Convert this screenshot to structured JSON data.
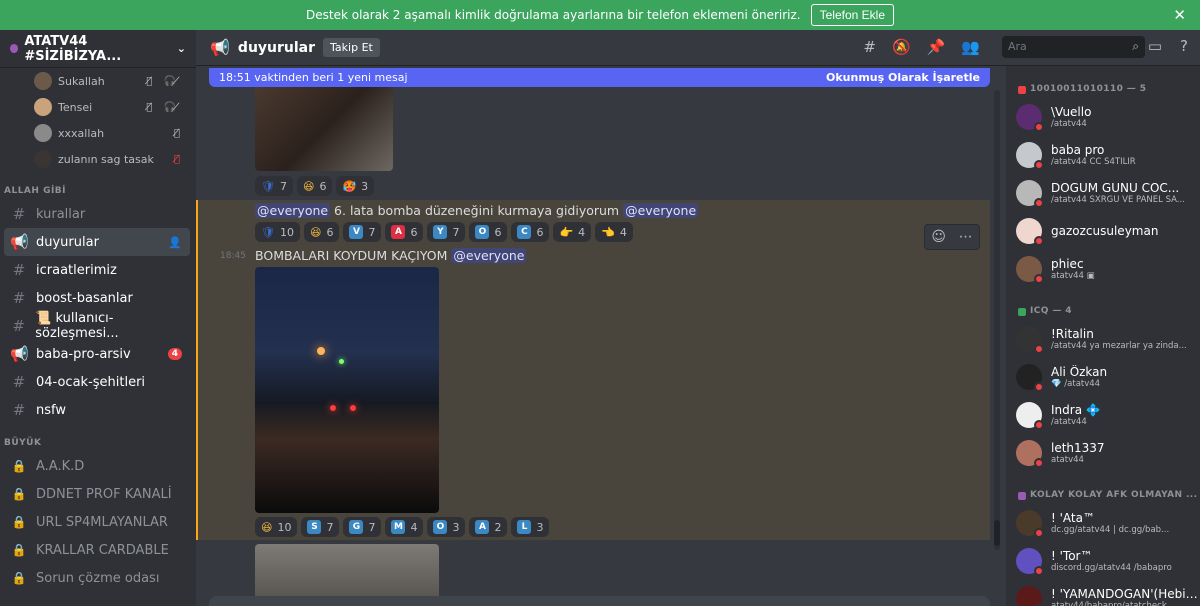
{
  "banner": {
    "text": "Destek olarak 2 aşamalı kimlik doğrulama ayarlarına bir telefon eklemeni öneririz.",
    "button": "Telefon Ekle",
    "close": "✕"
  },
  "server": {
    "name": "ATATV44 #SİZİBİZYA...",
    "chevron": "⌄"
  },
  "voice_users": [
    {
      "name": "Sukallah",
      "icons": "🎙̸ 🎧̸"
    },
    {
      "name": "Tensei",
      "icons": "🎙̸ 🎧̸"
    },
    {
      "name": "xxxallah",
      "icons": "🎙̸"
    },
    {
      "name": "zulanın sag tasak",
      "icons": "🎙̸"
    }
  ],
  "categories": {
    "allah": "ALLAH GİBİ",
    "buyuk": "BÜYÜK"
  },
  "channels_allah": [
    {
      "name": "kurallar",
      "icon": "#",
      "state": "muted"
    },
    {
      "name": "duyurular",
      "icon": "📢",
      "state": "active"
    },
    {
      "name": "icraatlerimiz",
      "icon": "#",
      "state": "unread"
    },
    {
      "name": "boost-basanlar",
      "icon": "#",
      "state": "unread"
    },
    {
      "name": "📜 kullanıcı-sözleşmesi...",
      "icon": "#",
      "state": "unread"
    },
    {
      "name": "baba-pro-arsiv",
      "icon": "📢",
      "state": "unread",
      "badge": "4"
    },
    {
      "name": "04-ocak-şehitleri",
      "icon": "#",
      "state": "unread"
    },
    {
      "name": "nsfw",
      "icon": "#",
      "state": "unread"
    }
  ],
  "channels_buyuk": [
    {
      "name": "A.A.K.D"
    },
    {
      "name": "DDNET PROF KANALİ"
    },
    {
      "name": "URL SP4MLAYANLAR"
    },
    {
      "name": "KRALLAR CARDABLE"
    },
    {
      "name": "Sorun çözme odası"
    }
  ],
  "topbar": {
    "channel": "duyurular",
    "follow": "Takip Et",
    "search_placeholder": "Ara"
  },
  "new_messages": {
    "text": "18:51 vaktinden beri 1 yeni mesaj",
    "mark_read": "Okunmuş Olarak İşaretle"
  },
  "messages": {
    "reactions1": [
      {
        "e": "🛡",
        "n": "7",
        "c": "#3b6fd4"
      },
      {
        "e": "😆",
        "n": "6",
        "c": "#f5b83d"
      },
      {
        "e": "🥵",
        "n": "3",
        "c": "#e26b6b"
      }
    ],
    "msg2": {
      "mention1": "@everyone",
      "text": " 6. lata bomba düzeneğini kurmaya gidiyorum ",
      "mention2": "@everyone"
    },
    "reactions2": [
      {
        "e": "🛡",
        "n": "10",
        "c": "#3b6fd4"
      },
      {
        "e": "😆",
        "n": "6",
        "c": "#f5b83d"
      },
      {
        "l": "V",
        "n": "7",
        "c": "#3b88c3"
      },
      {
        "l": "A",
        "n": "6",
        "c": "#dd2e44"
      },
      {
        "l": "Y",
        "n": "7",
        "c": "#3b88c3"
      },
      {
        "l": "O",
        "n": "6",
        "c": "#3b88c3"
      },
      {
        "l": "C",
        "n": "6",
        "c": "#3b88c3"
      },
      {
        "e": "👉",
        "n": "4",
        "c": "#f5b83d"
      },
      {
        "e": "👈",
        "n": "4",
        "c": "#f5b83d"
      }
    ],
    "msg3": {
      "time": "18:45",
      "text": "BOMBALARI KOYDUM KAÇIYOM ",
      "mention": "@everyone"
    },
    "reactions3": [
      {
        "e": "😆",
        "n": "10",
        "c": "#f5b83d"
      },
      {
        "l": "S",
        "n": "7",
        "c": "#3b88c3"
      },
      {
        "l": "G",
        "n": "7",
        "c": "#3b88c3"
      },
      {
        "l": "M",
        "n": "4",
        "c": "#3b88c3"
      },
      {
        "l": "O",
        "n": "3",
        "c": "#3b88c3"
      },
      {
        "l": "A",
        "n": "2",
        "c": "#3b88c3"
      },
      {
        "l": "L",
        "n": "3",
        "c": "#3b88c3"
      }
    ]
  },
  "members": {
    "group1": {
      "title": "10010011010110 — 5",
      "color": "#ed4245"
    },
    "list1": [
      {
        "name": "\\Vuello",
        "sub": "/atatv44"
      },
      {
        "name": "baba pro",
        "sub": "/atatv44 CC S4TILIR"
      },
      {
        "name": "DOGUM GUNU COC...",
        "sub": "/atatv44 SXRGU VE PANEL SA..."
      },
      {
        "name": "gazozcusuleyman",
        "sub": ""
      },
      {
        "name": "phiec",
        "sub": "atatv44 ▣"
      }
    ],
    "group2": {
      "title": "ICQ — 4",
      "color": "#3ba55d"
    },
    "list2": [
      {
        "name": "!Ritalin",
        "sub": "/atatv44 ya mezarlar ya zinda..."
      },
      {
        "name": "Ali Özkan",
        "sub": "💎 /atatv44"
      },
      {
        "name": "Indra 💠",
        "sub": "/atatv44"
      },
      {
        "name": "leth1337",
        "sub": "atatv44"
      }
    ],
    "group3": {
      "title": "KOLAY KOLAY AFK OLMAYAN ...",
      "color": "#9b59b6"
    },
    "list3": [
      {
        "name": "! 'Ata™",
        "sub": "dc.gg/atatv44 | dc.gg/bab..."
      },
      {
        "name": "! 'Tor™",
        "sub": "discord.gg/atatv44 /babapro"
      },
      {
        "name": "! 'YAMANDOGAN'(Hebit...",
        "sub": "atatv44/babapro/atatcheck"
      }
    ]
  }
}
